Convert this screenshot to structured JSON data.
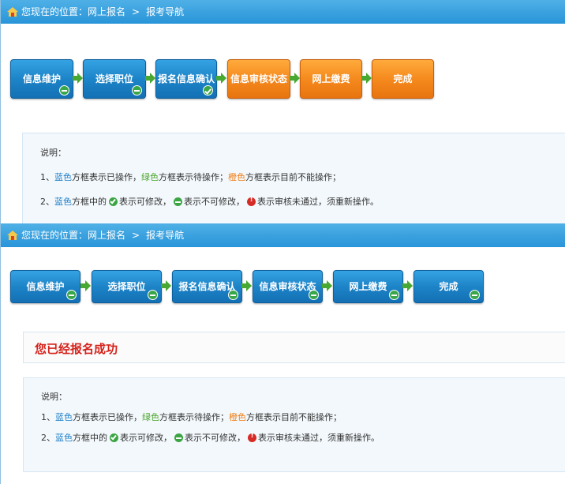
{
  "top_panel": {
    "breadcrumb": {
      "prefix": "您现在的位置：网上报名",
      "separator": ">",
      "current": "报考导航"
    },
    "steps": [
      {
        "label": "信息维护",
        "state": "blue",
        "badge": "minus"
      },
      {
        "label": "选择职位",
        "state": "blue",
        "badge": "minus"
      },
      {
        "label": "报名信息确认",
        "state": "blue",
        "badge": "check"
      },
      {
        "label": "信息审核状态",
        "state": "orange",
        "badge": ""
      },
      {
        "label": "网上缴费",
        "state": "orange",
        "badge": ""
      },
      {
        "label": "完成",
        "state": "orange",
        "badge": ""
      }
    ],
    "notes": {
      "title": "说明：",
      "line1": {
        "num": "1、",
        "blue": "蓝色",
        "t1": "方框表示已操作，",
        "green": "绿色",
        "t2": "方框表示待操作；",
        "orange": "橙色",
        "t3": "方框表示目前不能操作；"
      },
      "line2": {
        "num": "2、",
        "blue": "蓝色",
        "t1": "方框中的",
        "t2": "表示可修改，",
        "t3": "表示不可修改，",
        "t4": "表示审核未通过，须重新操作。"
      }
    }
  },
  "bottom_panel": {
    "breadcrumb": {
      "prefix": "您现在的位置：网上报名",
      "separator": ">",
      "current": "报考导航"
    },
    "steps": [
      {
        "label": "信息维护",
        "state": "blue",
        "badge": "minus"
      },
      {
        "label": "选择职位",
        "state": "blue",
        "badge": "minus"
      },
      {
        "label": "报名信息确认",
        "state": "blue",
        "badge": "minus"
      },
      {
        "label": "信息审核状态",
        "state": "blue",
        "badge": "minus"
      },
      {
        "label": "网上缴费",
        "state": "blue",
        "badge": "minus"
      },
      {
        "label": "完成",
        "state": "blue",
        "badge": "minus"
      }
    ],
    "success_message": "您已经报名成功",
    "notes": {
      "title": "说明：",
      "line1": {
        "num": "1、",
        "blue": "蓝色",
        "t1": "方框表示已操作，",
        "green": "绿色",
        "t2": "方框表示待操作；",
        "orange": "橙色",
        "t3": "方框表示目前不能操作；"
      },
      "line2": {
        "num": "2、",
        "blue": "蓝色",
        "t1": "方框中的",
        "t2": "表示可修改，",
        "t3": "表示不可修改，",
        "t4": "表示审核未通过，须重新操作。"
      }
    }
  },
  "colors": {
    "header": "#2894d8",
    "blue_step": "#1d84c8",
    "orange_step": "#f58a1e",
    "arrow": "#48a832",
    "success": "#d5231c"
  },
  "icons": {
    "home": "home-icon",
    "arrow": "arrow-right-icon",
    "check": "check-icon",
    "minus": "minus-icon",
    "error": "error-icon"
  }
}
